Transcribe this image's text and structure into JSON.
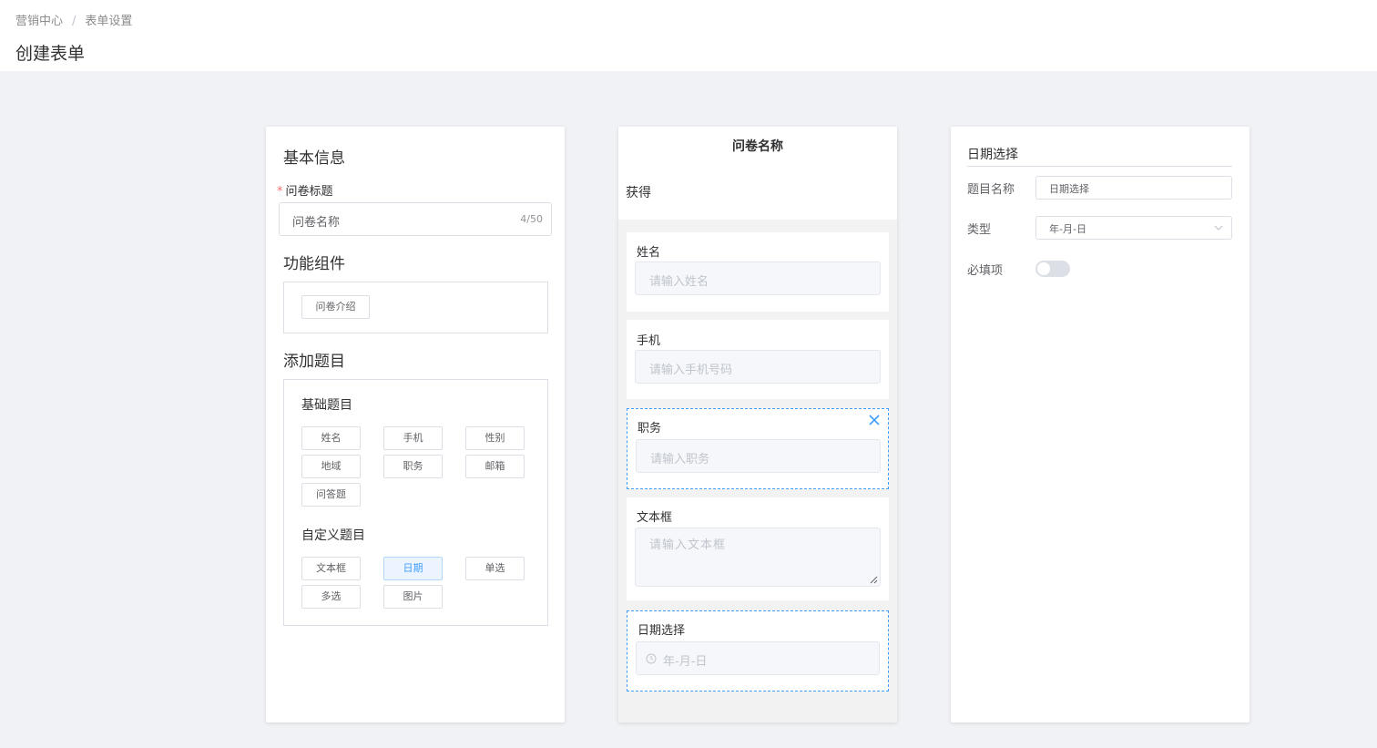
{
  "breadcrumb": {
    "root": "营销中心",
    "separator": "/",
    "current": "表单设置"
  },
  "page_title": "创建表单",
  "left": {
    "basic_info_title": "基本信息",
    "questionnaire_title_label": "问卷标题",
    "questionnaire_title_value": "问卷名称",
    "questionnaire_title_count": "4/50",
    "function_components_title": "功能组件",
    "function_components": [
      "问卷介绍"
    ],
    "add_questions_title": "添加题目",
    "basic_questions_title": "基础题目",
    "basic_questions": [
      "姓名",
      "手机",
      "性别",
      "地域",
      "职务",
      "邮箱",
      "问答题"
    ],
    "custom_questions_title": "自定义题目",
    "custom_questions": [
      "文本框",
      "日期",
      "单选",
      "多选",
      "图片"
    ],
    "active_custom_question": "日期"
  },
  "preview": {
    "questionnaire_name": "问卷名称",
    "intro_text": "获得",
    "questions": [
      {
        "label": "姓名",
        "placeholder": "请输入姓名"
      },
      {
        "label": "手机",
        "placeholder": "请输入手机号码"
      },
      {
        "label": "职务",
        "placeholder": "请输入职务"
      },
      {
        "label": "文本框",
        "placeholder": "请输入文本框"
      },
      {
        "label": "日期选择",
        "placeholder": "年-月-日"
      }
    ]
  },
  "settings": {
    "title": "日期选择",
    "name_label": "题目名称",
    "name_value": "日期选择",
    "type_label": "类型",
    "type_value": "年-月-日",
    "required_label": "必填项",
    "required_on": false
  },
  "colors": {
    "accent": "#409eff",
    "required_star": "#f56c6c",
    "background": "#f0f2f5"
  }
}
